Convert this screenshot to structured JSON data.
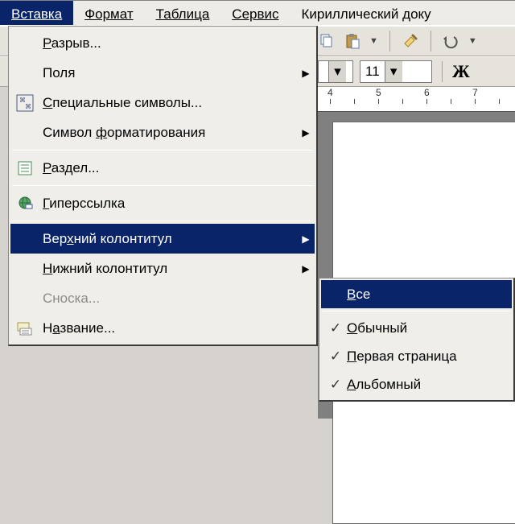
{
  "menubar": {
    "items": [
      {
        "label": "Вставка",
        "u": 0,
        "active": true
      },
      {
        "label": "Формат",
        "u": 0
      },
      {
        "label": "Таблица",
        "u": 0
      },
      {
        "label": "Сервис",
        "u": 0
      },
      {
        "label": "Кириллический доку",
        "u": -1
      }
    ]
  },
  "toolbar": {
    "font_size": "11",
    "bold": "Ж"
  },
  "ruler": {
    "numbers": [
      "4",
      "5",
      "6",
      "7"
    ]
  },
  "insert_menu": {
    "items": [
      {
        "label": "Разрыв...",
        "u": 0,
        "icon": "",
        "submenu": false
      },
      {
        "label": "Поля",
        "u": -1,
        "icon": "",
        "submenu": true
      },
      {
        "label": "Специальные символы...",
        "u": 0,
        "icon": "special",
        "submenu": false
      },
      {
        "label": "Символ форматирования",
        "u": 7,
        "icon": "",
        "submenu": true
      },
      {
        "sep": true
      },
      {
        "label": "Раздел...",
        "u": 0,
        "icon": "section",
        "submenu": false
      },
      {
        "sep": true
      },
      {
        "label": "Гиперссылка",
        "u": 0,
        "icon": "link",
        "submenu": false
      },
      {
        "sep": true
      },
      {
        "label": "Верхний колонтитул",
        "u": 3,
        "icon": "",
        "submenu": true,
        "highlight": true
      },
      {
        "label": "Нижний колонтитул",
        "u": 0,
        "icon": "",
        "submenu": true
      },
      {
        "label": "Сноска...",
        "u": -1,
        "icon": "",
        "submenu": false,
        "disabled": true
      },
      {
        "label": "Название...",
        "u": 1,
        "icon": "caption",
        "submenu": false
      }
    ]
  },
  "header_submenu": {
    "items": [
      {
        "label": "Все",
        "u": 0,
        "check": false,
        "highlight": true
      },
      {
        "sep": true
      },
      {
        "label": "Обычный",
        "u": 0,
        "check": true
      },
      {
        "label": "Первая страница",
        "u": 0,
        "check": true
      },
      {
        "label": "Альбомный",
        "u": 0,
        "check": true
      }
    ]
  }
}
